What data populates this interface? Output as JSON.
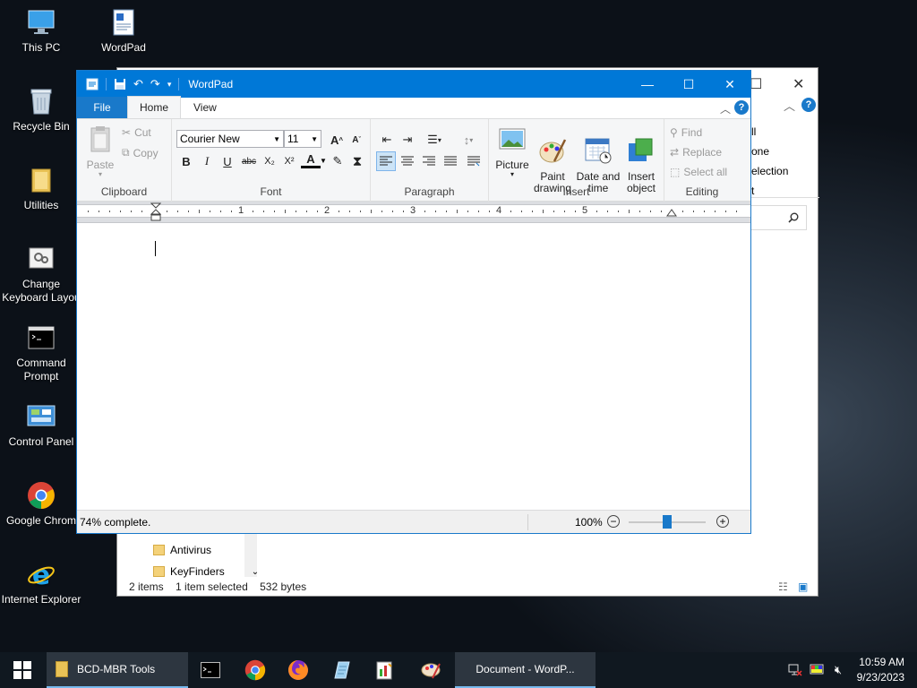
{
  "desktop": {
    "icons": [
      {
        "label": "This PC",
        "icon": "this-pc-icon"
      },
      {
        "label": "WordPad",
        "icon": "wordpad-icon"
      },
      {
        "label": "Recycle Bin",
        "icon": "recycle-bin-icon"
      },
      {
        "label": "Utilities",
        "icon": "folder-icon"
      },
      {
        "label": "Change\nKeyboard Layou",
        "icon": "keyboard-settings-icon"
      },
      {
        "label": "Command\nPrompt",
        "icon": "cmd-icon"
      },
      {
        "label": "Control Panel",
        "icon": "control-panel-icon"
      },
      {
        "label": "Google Chrom",
        "icon": "chrome-icon"
      },
      {
        "label": "Internet Explorer",
        "icon": "ie-icon"
      }
    ]
  },
  "explorer": {
    "ribbon_fragments": [
      "ll",
      "one",
      "election",
      "t"
    ],
    "tree": [
      {
        "label": "Antivirus"
      },
      {
        "label": "KeyFinders"
      }
    ],
    "status": {
      "items": "2 items",
      "selected": "1 item selected",
      "size": "532 bytes"
    }
  },
  "wordpad": {
    "title": "WordPad",
    "tabs": {
      "file": "File",
      "home": "Home",
      "view": "View"
    },
    "help": "?",
    "clipboard": {
      "paste": "Paste",
      "cut": "Cut",
      "copy": "Copy",
      "label": "Clipboard"
    },
    "font": {
      "family": "Courier New",
      "size": "11",
      "label": "Font",
      "bold": "B",
      "italic": "I",
      "underline": "U",
      "strike": "abc",
      "subscript": "X₂",
      "superscript": "X²",
      "grow": "A",
      "shrink": "A",
      "color": "A"
    },
    "paragraph": {
      "label": "Paragraph"
    },
    "insert": {
      "picture": "Picture",
      "paint": "Paint\ndrawing",
      "datetime": "Date and\ntime",
      "object": "Insert\nobject",
      "label": "Insert"
    },
    "editing": {
      "find": "Find",
      "replace": "Replace",
      "select_all": "Select all",
      "label": "Editing"
    },
    "ruler": [
      "1",
      "2",
      "3",
      "4",
      "5"
    ],
    "status": {
      "message": "74% complete.",
      "zoom": "100%",
      "zoom_level_percent": 50
    }
  },
  "taskbar": {
    "tasks": [
      {
        "label": "BCD-MBR Tools"
      },
      {
        "label": "Document - WordP..."
      }
    ],
    "clock": {
      "time": "10:59 AM",
      "date": "9/23/2023"
    }
  }
}
